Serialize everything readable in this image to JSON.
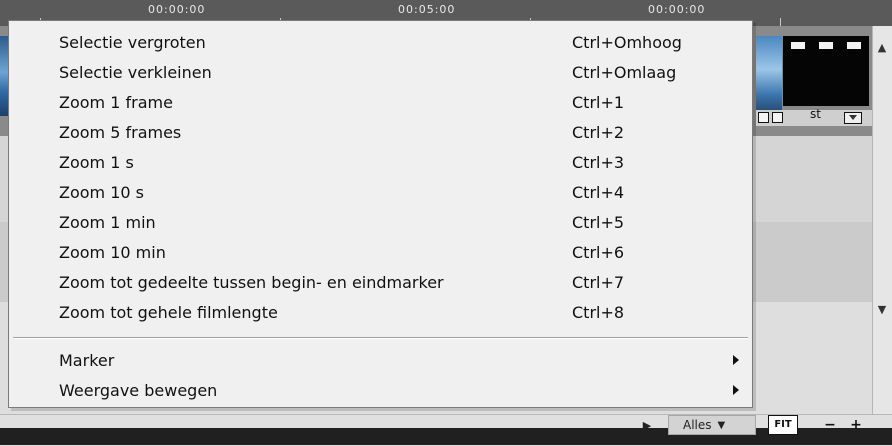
{
  "timeline": {
    "ruler_times": [
      "00:00:00",
      "00:05:00",
      "00:00:00"
    ],
    "clip_label": "st"
  },
  "menu": {
    "items": [
      {
        "label": "Selectie vergroten",
        "shortcut": "Ctrl+Omhoog"
      },
      {
        "label": "Selectie verkleinen",
        "shortcut": "Ctrl+Omlaag"
      },
      {
        "label": "Zoom 1 frame",
        "shortcut": "Ctrl+1"
      },
      {
        "label": "Zoom 5 frames",
        "shortcut": "Ctrl+2"
      },
      {
        "label": "Zoom 1 s",
        "shortcut": "Ctrl+3"
      },
      {
        "label": "Zoom 10 s",
        "shortcut": "Ctrl+4"
      },
      {
        "label": "Zoom 1 min",
        "shortcut": "Ctrl+5"
      },
      {
        "label": "Zoom 10 min",
        "shortcut": "Ctrl+6"
      },
      {
        "label": "Zoom tot gedeelte tussen begin- en eindmarker",
        "shortcut": "Ctrl+7"
      },
      {
        "label": "Zoom tot gehele filmlengte",
        "shortcut": "Ctrl+8"
      }
    ],
    "submenus": [
      {
        "label": "Marker"
      },
      {
        "label": "Weergave bewegen"
      }
    ]
  },
  "toolbar": {
    "play_icon": "play-icon",
    "zoom_select_label": "Alles",
    "fit_label": "FIT",
    "minus_label": "−",
    "plus_label": "+"
  }
}
